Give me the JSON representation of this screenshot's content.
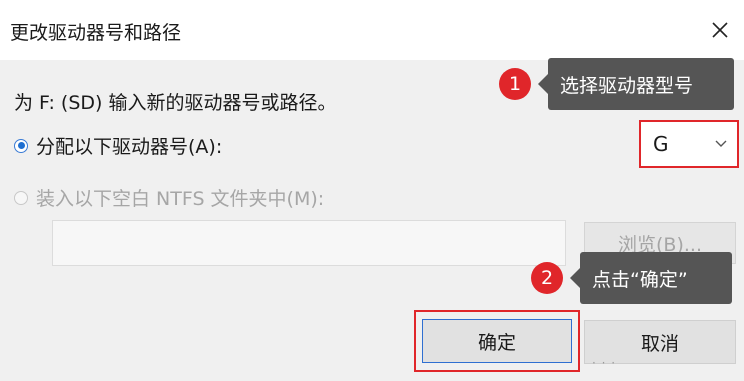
{
  "dialog": {
    "title": "更改驱动器号和路径",
    "prompt": "为 F: (SD) 输入新的驱动器号或路径。",
    "assign_option": "分配以下驱动器号(A):",
    "mount_option": "装入以下空白 NTFS 文件夹中(M):",
    "drive_letter": "G",
    "path_value": "",
    "browse_label": "浏览(B)...",
    "ok_label": "确定",
    "cancel_label": "取消"
  },
  "annotations": {
    "step1_number": "1",
    "step1_text": "选择驱动器型号",
    "step2_number": "2",
    "step2_text": "点击“确定”"
  },
  "colors": {
    "accent": "#e0262a",
    "callout_bg": "#555555",
    "selected_radio": "#1f6fd1"
  },
  "icons": [
    "close-icon",
    "chevron-down-icon"
  ],
  "watermark": "· · ·"
}
